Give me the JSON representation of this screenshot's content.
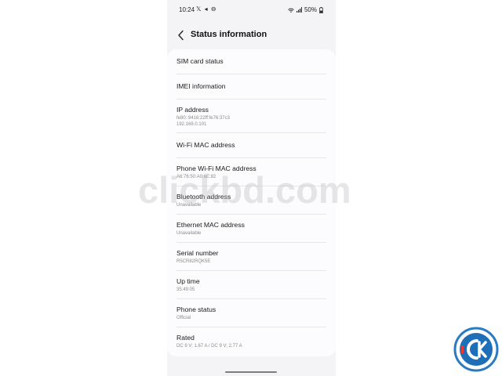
{
  "status_bar": {
    "time": "10:24",
    "left_icons": "𝕏 ◂ ⊖",
    "battery": "50%"
  },
  "header": {
    "title": "Status information"
  },
  "items": [
    {
      "title": "SIM card status"
    },
    {
      "title": "IMEI information"
    },
    {
      "title": "IP address",
      "sub1": "fe80::9416:22ff:fe76:37c3",
      "sub2": "192.168.0.101"
    },
    {
      "title": "Wi-Fi MAC address"
    },
    {
      "title": "Phone Wi-Fi MAC address",
      "sub1": "A6:76:50:A0:6E:82"
    },
    {
      "title": "Bluetooth address",
      "sub1": "Unavailable"
    },
    {
      "title": "Ethernet MAC address",
      "sub1": "Unavailable"
    },
    {
      "title": "Serial number",
      "sub1": "R5CR82RQK5E"
    },
    {
      "title": "Up time",
      "sub1": "35:49:05"
    },
    {
      "title": "Phone status",
      "sub1": "Official"
    },
    {
      "title": "Rated",
      "sub1": "DC 9 V; 1.67 A / DC 9 V; 2.77 A"
    }
  ],
  "watermark": "clickbd.com",
  "colors": {
    "background": "#f4f4f6",
    "card": "#fcfcfe",
    "logo_blue": "#1f6fb8"
  }
}
